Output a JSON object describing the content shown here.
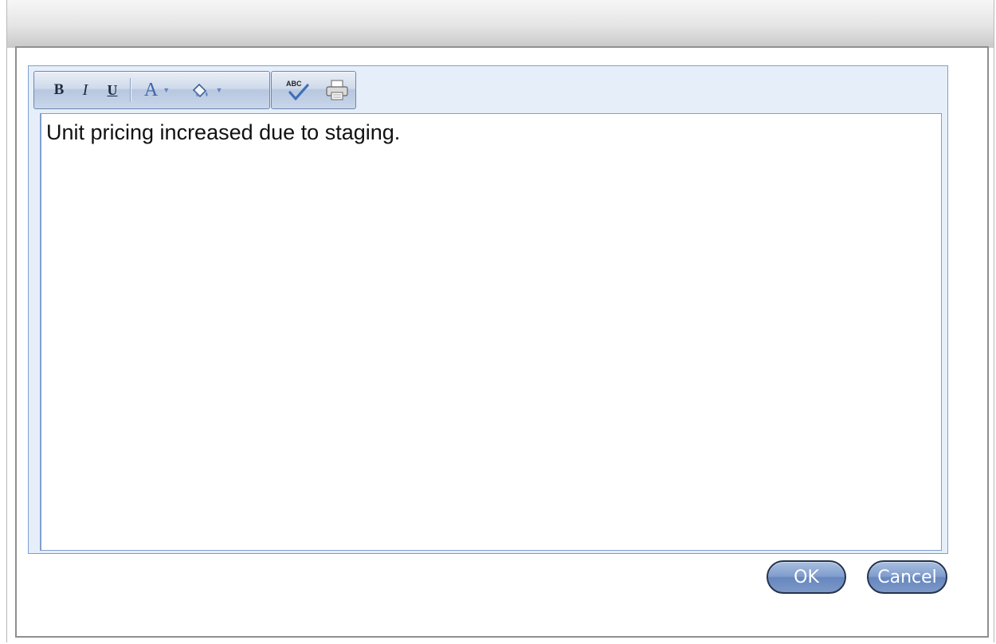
{
  "toolbar": {
    "bold_label": "B",
    "italic_label": "I",
    "underline_label": "U",
    "font_color_label": "A",
    "spellcheck_label": "ABC"
  },
  "editor": {
    "text": "Unit pricing increased due to staging."
  },
  "buttons": {
    "ok": "OK",
    "cancel": "Cancel"
  },
  "icons": [
    "bold-icon",
    "italic-icon",
    "underline-icon",
    "font-color-icon",
    "highlight-color-icon",
    "spellcheck-icon",
    "print-icon"
  ],
  "colors": {
    "accent": "#7f9ccc",
    "toolbar_bg": "#cfdaea",
    "editor_border": "#7f9fcf"
  }
}
